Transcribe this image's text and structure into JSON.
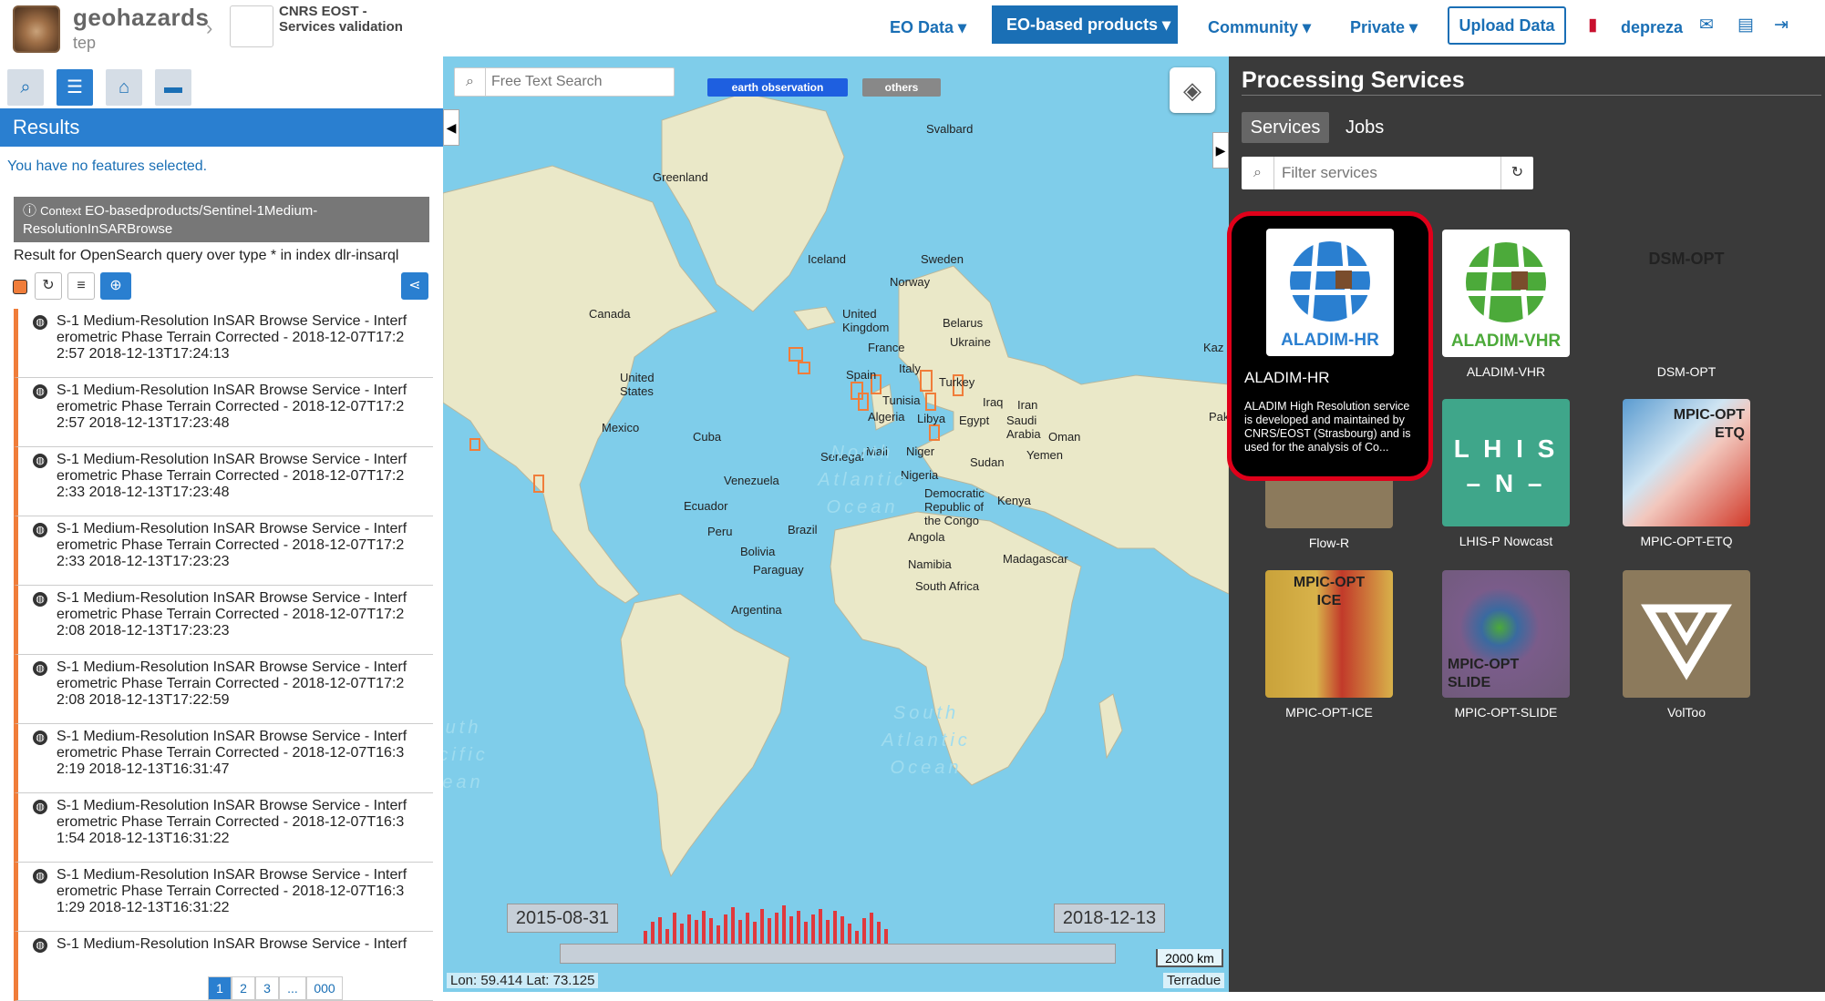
{
  "header": {
    "brand": "geohazards",
    "brand_sub": "tep",
    "project_name": "CNRS EOST - Services validation",
    "nav": {
      "eo_data": "EO Data ▾",
      "eo_products": "EO-based products ▾",
      "community": "Community ▾",
      "private": "Private ▾",
      "upload": "Upload Data",
      "user": "depreza"
    },
    "icons": [
      "book-icon",
      "user-icon",
      "mail-icon",
      "docs-icon",
      "logout-icon"
    ]
  },
  "left_panel": {
    "tabs": [
      "search-icon",
      "list-icon",
      "basket-icon",
      "archive-icon"
    ],
    "results_title": "Results",
    "no_features": "You have no features selected.",
    "context_prefix": "Context",
    "context_value": "EO-basedproducts/Sentinel-1Medium-ResolutionInSARBrowse",
    "query_text": "Result for OpenSearch query over type * in index dlr-insarql",
    "items": [
      {
        "line1": "S-1 Medium-Resolution InSAR Browse Service - Interf",
        "line2": "erometric Phase Terrain Corrected - 2018-12-07T17:2",
        "line3": "2:57 2018-12-13T17:24:13"
      },
      {
        "line1": "S-1 Medium-Resolution InSAR Browse Service - Interf",
        "line2": "erometric Phase Terrain Corrected - 2018-12-07T17:2",
        "line3": "2:57 2018-12-13T17:23:48"
      },
      {
        "line1": "S-1 Medium-Resolution InSAR Browse Service - Interf",
        "line2": "erometric Phase Terrain Corrected - 2018-12-07T17:2",
        "line3": "2:33 2018-12-13T17:23:48"
      },
      {
        "line1": "S-1 Medium-Resolution InSAR Browse Service - Interf",
        "line2": "erometric Phase Terrain Corrected - 2018-12-07T17:2",
        "line3": "2:33 2018-12-13T17:23:23"
      },
      {
        "line1": "S-1 Medium-Resolution InSAR Browse Service - Interf",
        "line2": "erometric Phase Terrain Corrected - 2018-12-07T17:2",
        "line3": "2:08 2018-12-13T17:23:23"
      },
      {
        "line1": "S-1 Medium-Resolution InSAR Browse Service - Interf",
        "line2": "erometric Phase Terrain Corrected - 2018-12-07T17:2",
        "line3": "2:08 2018-12-13T17:22:59"
      },
      {
        "line1": "S-1 Medium-Resolution InSAR Browse Service - Interf",
        "line2": "erometric Phase Terrain Corrected - 2018-12-07T16:3",
        "line3": "2:19 2018-12-13T16:31:47"
      },
      {
        "line1": "S-1 Medium-Resolution InSAR Browse Service - Interf",
        "line2": "erometric Phase Terrain Corrected - 2018-12-07T16:3",
        "line3": "1:54 2018-12-13T16:31:22"
      },
      {
        "line1": "S-1 Medium-Resolution InSAR Browse Service - Interf",
        "line2": "erometric Phase Terrain Corrected - 2018-12-07T16:3",
        "line3": "1:29 2018-12-13T16:31:22"
      },
      {
        "line1": "S-1 Medium-Resolution InSAR Browse Service - Interf",
        "line2": "",
        "line3": ""
      }
    ],
    "pager": [
      "1",
      "2",
      "3",
      "...",
      "000"
    ]
  },
  "map": {
    "search_placeholder": "Free Text Search",
    "tag_eo": "earth observation",
    "tag_others": "others",
    "labels": {
      "greenland": "Greenland",
      "svalbard": "Svalbard",
      "iceland": "Iceland",
      "sweden": "Sweden",
      "norway": "Norway",
      "canada": "Canada",
      "uk": "United Kingdom",
      "belarus": "Belarus",
      "ukraine": "Ukraine",
      "france": "France",
      "us": "United States",
      "spain": "Spain",
      "italy": "Italy",
      "turkey": "Turkey",
      "tunisia": "Tunisia",
      "iraq": "Iraq",
      "iran": "Iran",
      "mexico": "Mexico",
      "cuba": "Cuba",
      "algeria": "Algeria",
      "libya": "Libya",
      "egypt": "Egypt",
      "saudi": "Saudi Arabia",
      "oman": "Oman",
      "yemen": "Yemen",
      "senegal": "Senegal",
      "mali": "Mali",
      "niger": "Niger",
      "sudan": "Sudan",
      "nigeria": "Nigeria",
      "venezuela": "Venezuela",
      "ecuador": "Ecuador",
      "drc": "Democratic Republic of the Congo",
      "kenya": "Kenya",
      "peru": "Peru",
      "brazil": "Brazil",
      "bolivia": "Bolivia",
      "angola": "Angola",
      "paraguay": "Paraguay",
      "madagascar": "Madagascar",
      "namibia": "Namibia",
      "argentina": "Argentina",
      "south_africa": "South Africa",
      "kaz": "Kaz",
      "pak": "Pak"
    },
    "oceans": {
      "north_atlantic": "North Atlantic Ocean",
      "south_atlantic": "South Atlantic Ocean",
      "south_pacific": "outh acific cean"
    },
    "date_start": "2015-08-31",
    "date_end": "2018-12-13",
    "scale": "2000 km",
    "coords": "Lon: 59.414 Lat: 73.125",
    "attribution": "Terradue"
  },
  "right_panel": {
    "title": "Processing Services",
    "tab_services": "Services",
    "tab_jobs": "Jobs",
    "filter_placeholder": "Filter services",
    "popup": {
      "thumb_label": "ALADIM-HR",
      "name": "ALADIM-HR",
      "description": "ALADIM High Resolution service is developed and maintained by CNRS/EOST (Strasbourg) and is used for the analysis of Co..."
    },
    "services": [
      {
        "label": "ALADIM-VHR",
        "thumb_text": "ALADIM-VHR"
      },
      {
        "label": "DSM-OPT",
        "thumb_text": "DSM-OPT"
      },
      {
        "label": "Flow-R",
        "thumb_text": ""
      },
      {
        "label": "LHIS-P Nowcast",
        "thumb_text": "L H I S\n– N –"
      },
      {
        "label": "MPIC-OPT-ETQ",
        "thumb_text": "MPIC-OPT\nETQ"
      },
      {
        "label": "MPIC-OPT-ICE",
        "thumb_text": "MPIC-OPT\nICE"
      },
      {
        "label": "MPIC-OPT-SLIDE",
        "thumb_text": "MPIC-OPT\nSLIDE"
      },
      {
        "label": "VolToo",
        "thumb_text": ""
      }
    ]
  }
}
